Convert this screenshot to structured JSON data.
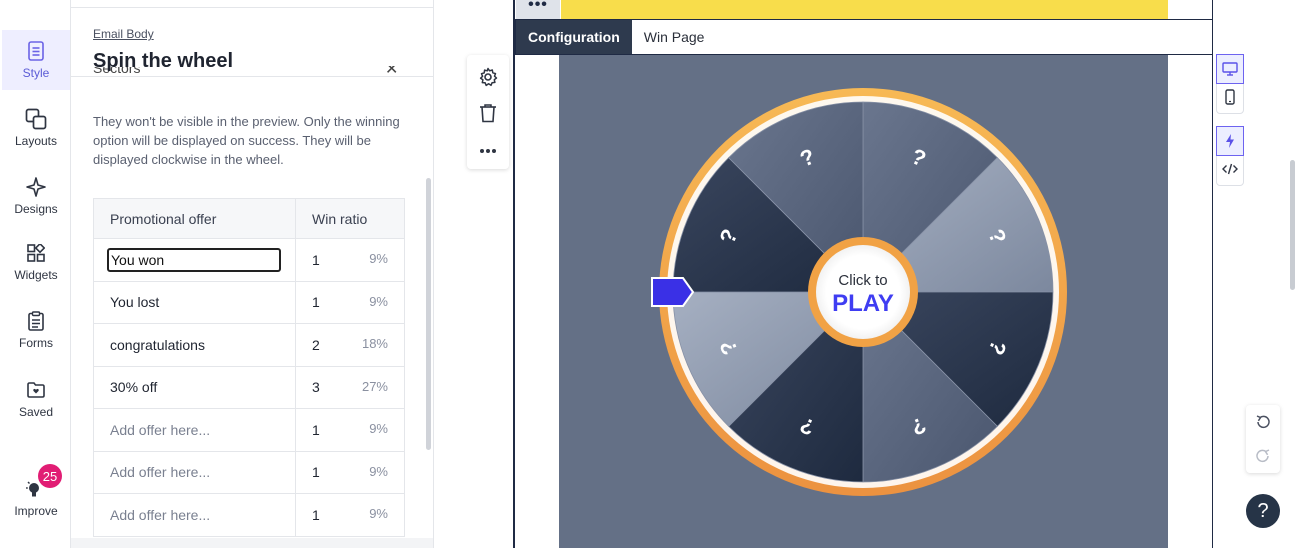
{
  "rail": {
    "items": [
      {
        "label": "Style",
        "icon": "style-icon"
      },
      {
        "label": "Layouts",
        "icon": "layouts-icon"
      },
      {
        "label": "Designs",
        "icon": "designs-icon"
      },
      {
        "label": "Widgets",
        "icon": "widgets-icon"
      },
      {
        "label": "Forms",
        "icon": "forms-icon"
      },
      {
        "label": "Saved",
        "icon": "saved-icon"
      },
      {
        "label": "Improve",
        "icon": "bulb-icon"
      }
    ],
    "improve_badge": "25"
  },
  "panel": {
    "breadcrumb": "Email Body",
    "title": "Spin the wheel",
    "section_cut": "Sectors",
    "description": "They won't be visible in the preview. Only the winning option will be displayed on success. They will be displayed clockwise in the wheel.",
    "table": {
      "headers": [
        "Promotional offer",
        "Win ratio"
      ],
      "rows": [
        {
          "offer": "You won",
          "ratio": "1",
          "pct": "9%",
          "editing": true,
          "placeholder": false
        },
        {
          "offer": "You lost",
          "ratio": "1",
          "pct": "9%",
          "editing": false,
          "placeholder": false
        },
        {
          "offer": "congratulations",
          "ratio": "2",
          "pct": "18%",
          "editing": false,
          "placeholder": false
        },
        {
          "offer": "30% off",
          "ratio": "3",
          "pct": "27%",
          "editing": false,
          "placeholder": false
        },
        {
          "offer": "Add offer here...",
          "ratio": "1",
          "pct": "9%",
          "editing": false,
          "placeholder": true
        },
        {
          "offer": "Add offer here...",
          "ratio": "1",
          "pct": "9%",
          "editing": false,
          "placeholder": true
        },
        {
          "offer": "Add offer here...",
          "ratio": "1",
          "pct": "9%",
          "editing": false,
          "placeholder": true
        }
      ]
    }
  },
  "canvas": {
    "dots_label": "•••",
    "tabs": [
      {
        "label": "Configuration",
        "active": true
      },
      {
        "label": "Win Page",
        "active": false
      }
    ],
    "wheel": {
      "center_line1": "Click to",
      "center_line2": "PLAY",
      "sector_symbol": "?",
      "sector_count": 8,
      "colors": {
        "rim": "#f0a64a",
        "center": "#3f3df2",
        "pointer": "#3a30e6",
        "background": "#647086"
      }
    }
  },
  "help_label": "?"
}
